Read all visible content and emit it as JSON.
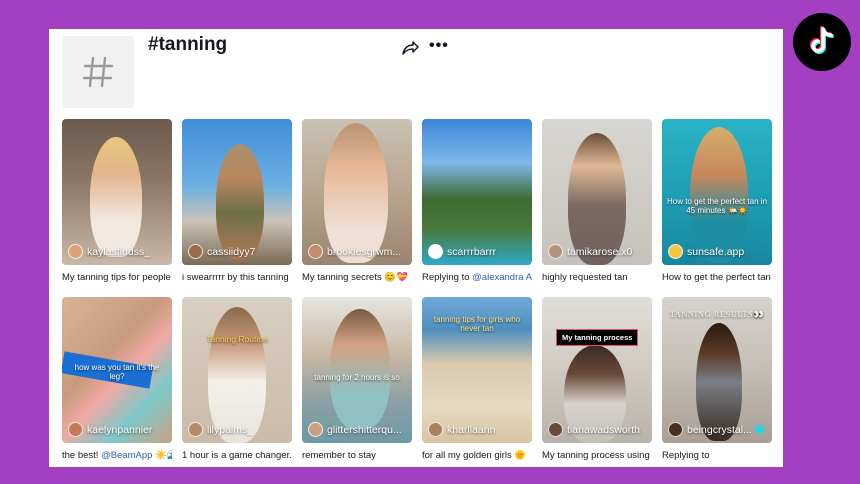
{
  "header": {
    "title": "#tanning"
  },
  "colors": {
    "background": "#a33fc0",
    "mention": "#2b5db9"
  },
  "videos": [
    {
      "username": "kaylasfindss_",
      "caption": "My tanning tips for people"
    },
    {
      "username": "cassiidyy7",
      "caption": "i swearrrrr by this tanning"
    },
    {
      "username": "brookiesgrwm...",
      "caption": "My tanning secrets 😊💝"
    },
    {
      "username": "scarrrbarrr",
      "caption_prefix": "Replying to ",
      "caption_mention": "@alexandra A"
    },
    {
      "username": "tamikarose.x0",
      "caption": "highly requested tan"
    },
    {
      "username": "sunsafe.app",
      "caption": "How to get the perfect tan",
      "overlay": "How to get the perfect tan in 45 minutes 🌤️☀️"
    },
    {
      "username": "kaelynpannier",
      "caption_prefix": "the best! ",
      "caption_mention": "@BeamApp",
      "caption_suffix": " ☀️🌊",
      "overlay": "how was you tan it's the leg?"
    },
    {
      "username": "lilypalms_",
      "caption": "1 hour is a game changer.",
      "overlay": "Tanning Routine"
    },
    {
      "username": "glittershitterqu...",
      "caption": "remember to stay",
      "overlay": "tanning for 2 hours is so"
    },
    {
      "username": "kharllaann",
      "caption": "for all my golden girls 🌞",
      "overlay": "tanning tips for girls who never tan"
    },
    {
      "username": "tianawadsworth",
      "caption": "My tanning process using",
      "overlay": "My tanning process"
    },
    {
      "username": "beingcrystal...",
      "caption": "Replying to",
      "overlay": "TANNING RESULTS👀"
    }
  ]
}
